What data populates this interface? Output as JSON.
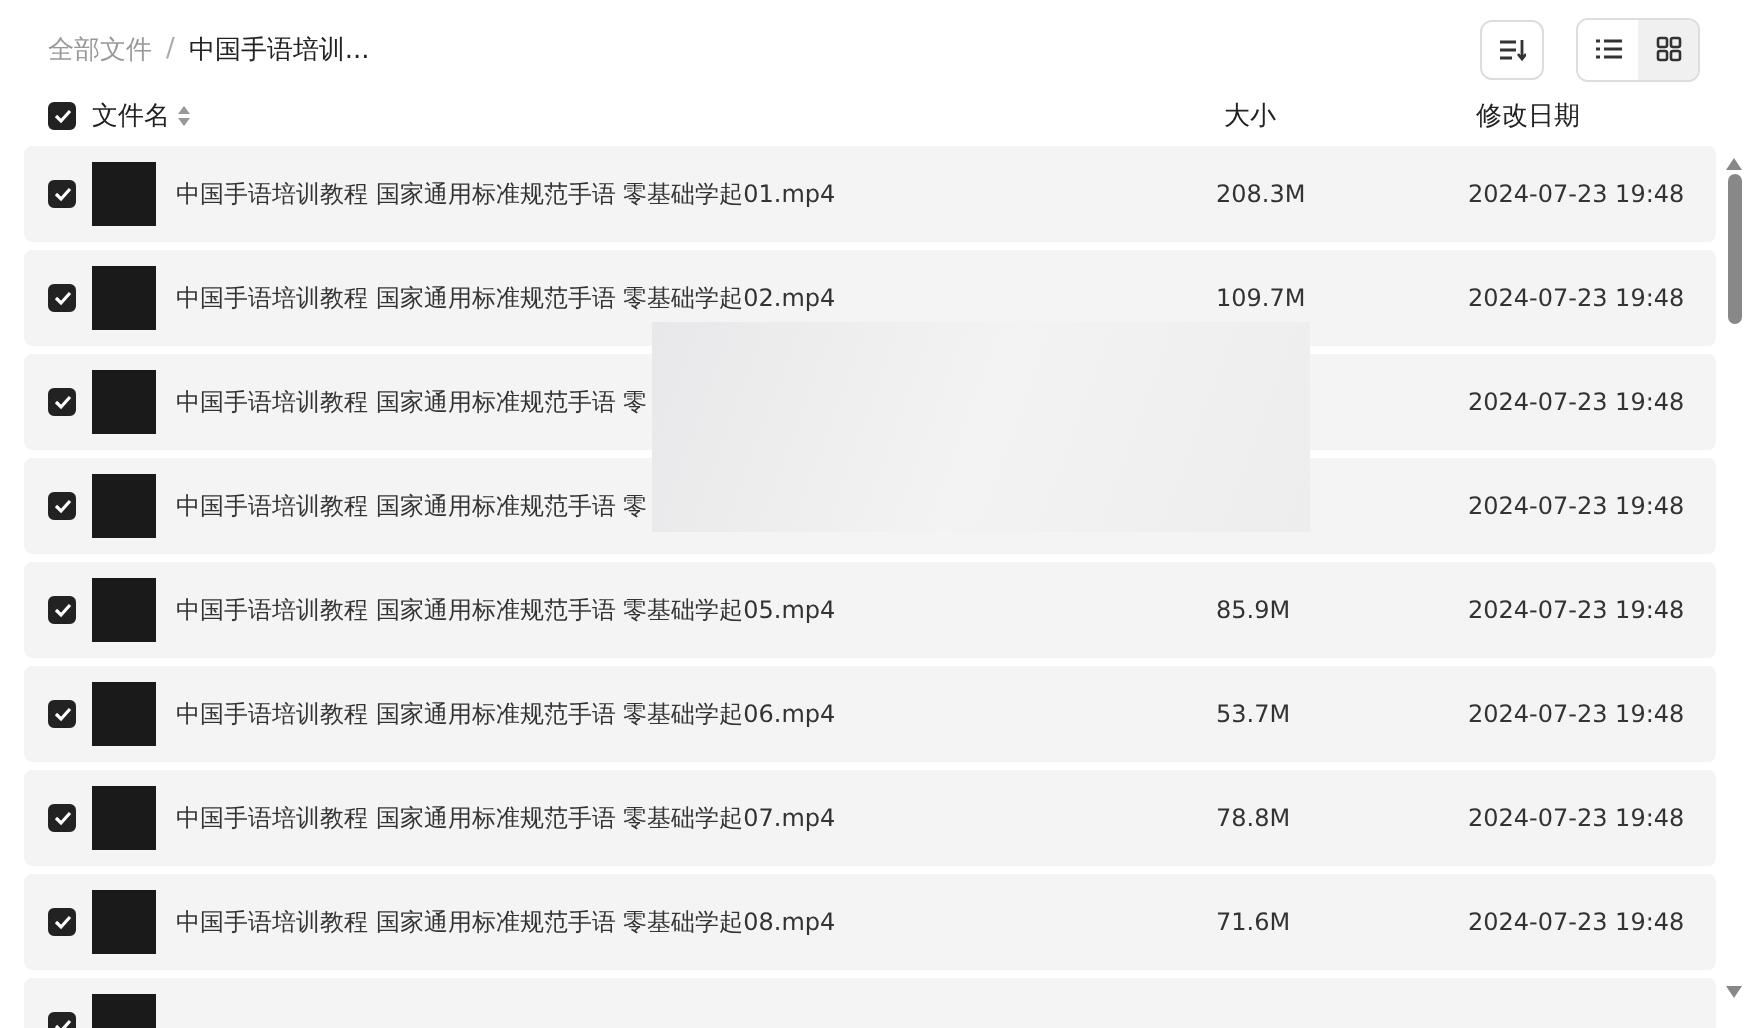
{
  "breadcrumb_separator": "/",
  "breadcrumb": [
    {
      "label": "全部文件",
      "current": false
    },
    {
      "label": "中国手语培训...",
      "current": true
    }
  ],
  "view_options": [
    {
      "kind": "list",
      "selected": false
    },
    {
      "kind": "grid",
      "selected": true
    }
  ],
  "table": {
    "select_all_checked": true,
    "columns": [
      {
        "label": "文件名",
        "sortable": true
      },
      {
        "label": "大小",
        "sortable": false
      },
      {
        "label": "修改日期",
        "sortable": false
      }
    ],
    "rows": [
      {
        "checked": true,
        "name": "中国手语培训教程 国家通用标准规范手语 零基础学起01.mp4",
        "size": "208.3M",
        "date": "2024-07-23 19:48"
      },
      {
        "checked": true,
        "name": "中国手语培训教程 国家通用标准规范手语 零基础学起02.mp4",
        "size": "109.7M",
        "date": "2024-07-23 19:48"
      },
      {
        "checked": true,
        "name": "中国手语培训教程 国家通用标准规范手语 零",
        "date": "2024-07-23 19:48"
      },
      {
        "checked": true,
        "name": "中国手语培训教程 国家通用标准规范手语 零",
        "date": "2024-07-23 19:48"
      },
      {
        "checked": true,
        "name": "中国手语培训教程 国家通用标准规范手语 零基础学起05.mp4",
        "size": "85.9M",
        "date": "2024-07-23 19:48"
      },
      {
        "checked": true,
        "name": "中国手语培训教程 国家通用标准规范手语 零基础学起06.mp4",
        "size": "53.7M",
        "date": "2024-07-23 19:48"
      },
      {
        "checked": true,
        "name": "中国手语培训教程 国家通用标准规范手语 零基础学起07.mp4",
        "size": "78.8M",
        "date": "2024-07-23 19:48"
      },
      {
        "checked": true,
        "name": "中国手语培训教程 国家通用标准规范手语 零基础学起08.mp4",
        "size": "71.6M",
        "date": "2024-07-23 19:48"
      },
      {
        "checked": true
      }
    ]
  }
}
